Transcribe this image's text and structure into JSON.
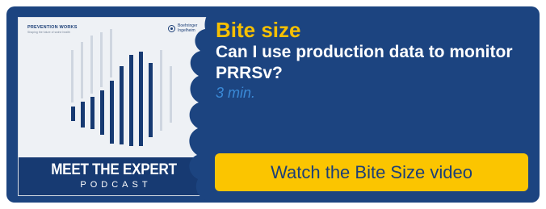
{
  "artwork": {
    "brand": "PREVENTION WORKS",
    "tagline": "Shaping the future of swine health",
    "partner": "Boehringer Ingelheim",
    "banner_title": "MEET THE EXPERT",
    "banner_subtitle": "PODCAST"
  },
  "content": {
    "kicker": "Bite size",
    "title": "Can I use production data to monitor PRRSv?",
    "duration": "3 min."
  },
  "cta": {
    "label": "Watch the Bite Size video"
  },
  "colors": {
    "card_background": "#1c4480",
    "kicker": "#f6c000",
    "duration": "#3a89d6",
    "button": "#fbc500",
    "button_text": "#1c3f77"
  }
}
